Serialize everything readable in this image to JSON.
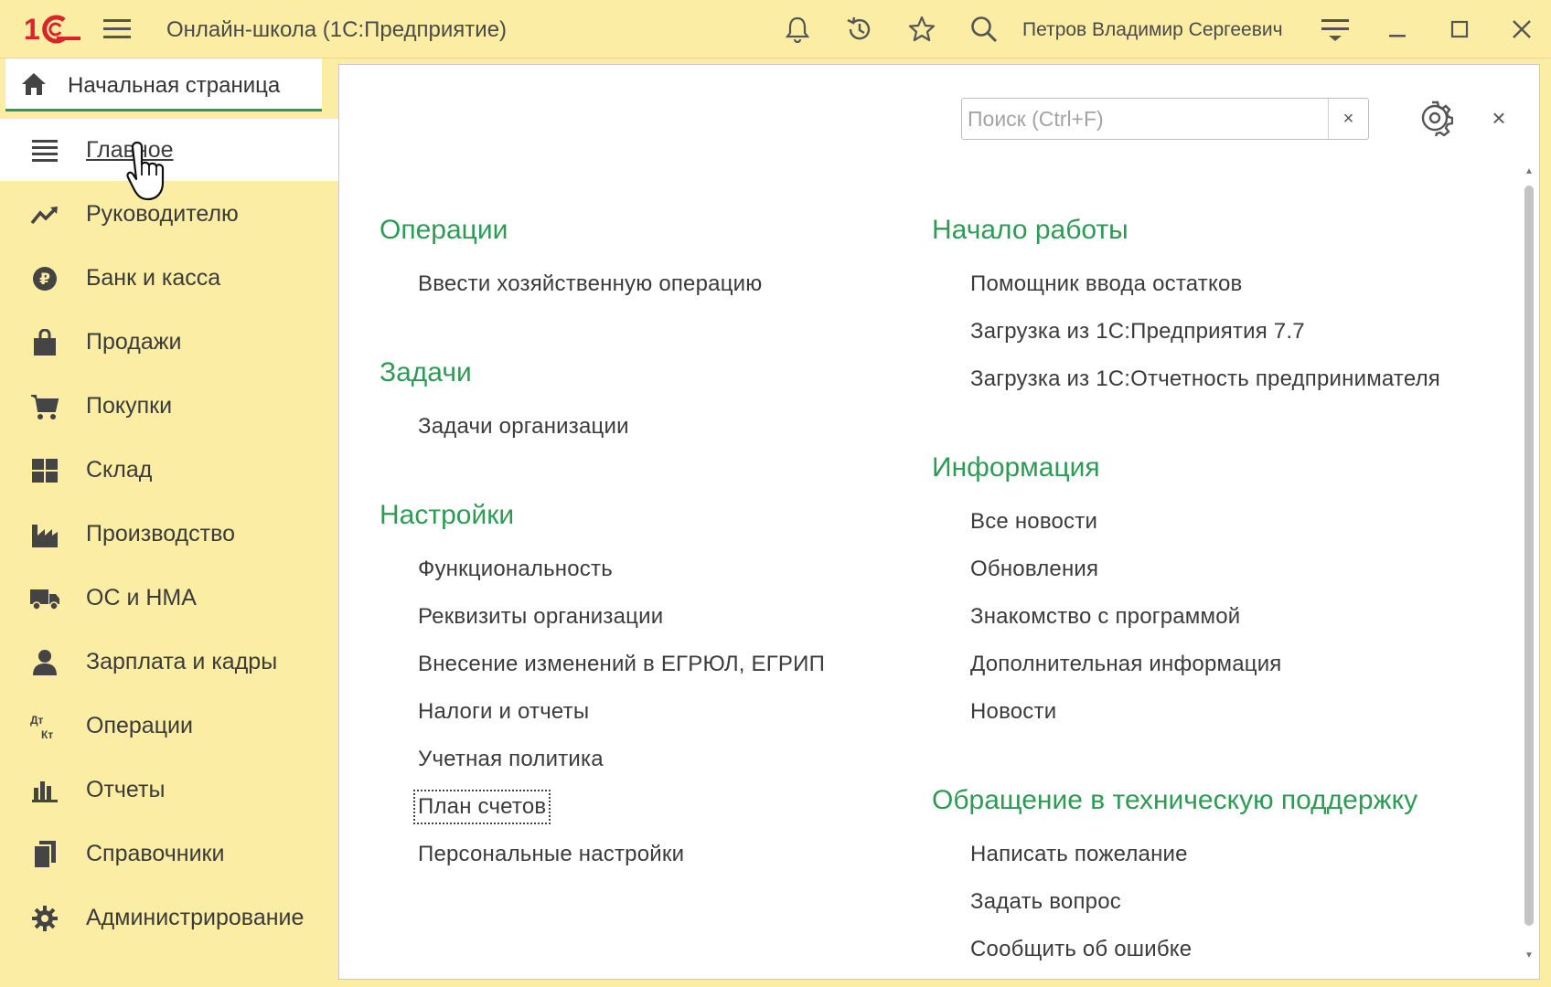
{
  "titlebar": {
    "title": "Онлайн-школа  (1С:Предприятие)",
    "user": "Петров Владимир Сергеевич"
  },
  "home_tab": {
    "label": "Начальная страница"
  },
  "sidebar": {
    "items": [
      {
        "label": "Главное",
        "icon": "menu-icon",
        "active": true
      },
      {
        "label": "Руководителю",
        "icon": "trend-icon"
      },
      {
        "label": "Банк и касса",
        "icon": "ruble-coin-icon"
      },
      {
        "label": "Продажи",
        "icon": "shopping-bag-icon"
      },
      {
        "label": "Покупки",
        "icon": "cart-icon"
      },
      {
        "label": "Склад",
        "icon": "warehouse-icon"
      },
      {
        "label": "Производство",
        "icon": "factory-icon"
      },
      {
        "label": "ОС и НМА",
        "icon": "truck-icon"
      },
      {
        "label": "Зарплата и кадры",
        "icon": "person-icon"
      },
      {
        "label": "Операции",
        "icon": "debit-credit-icon"
      },
      {
        "label": "Отчеты",
        "icon": "bar-chart-icon"
      },
      {
        "label": "Справочники",
        "icon": "books-icon"
      },
      {
        "label": "Администрирование",
        "icon": "gear-icon"
      }
    ]
  },
  "panel": {
    "search_placeholder": "Поиск (Ctrl+F)",
    "search_value": "",
    "clear_label": "×",
    "close_label": "×",
    "left": {
      "operations": {
        "title": "Операции",
        "links": [
          "Ввести хозяйственную операцию"
        ]
      },
      "tasks": {
        "title": "Задачи",
        "links": [
          "Задачи организации"
        ]
      },
      "settings": {
        "title": "Настройки",
        "links": [
          "Функциональность",
          "Реквизиты организации",
          "Внесение изменений в ЕГРЮЛ, ЕГРИП",
          "Налоги и отчеты",
          "Учетная политика",
          "План счетов",
          "Персональные настройки"
        ]
      }
    },
    "right": {
      "start": {
        "title": "Начало работы",
        "links": [
          "Помощник ввода остатков",
          "Загрузка из 1С:Предприятия 7.7",
          "Загрузка из 1С:Отчетность предпринимателя"
        ]
      },
      "info": {
        "title": "Информация",
        "links": [
          "Все новости",
          "Обновления",
          "Знакомство с программой",
          "Дополнительная информация",
          "Новости"
        ]
      },
      "support": {
        "title": "Обращение в техническую поддержку",
        "links": [
          "Написать пожелание",
          "Задать вопрос",
          "Сообщить об ошибке"
        ]
      }
    }
  },
  "colors": {
    "accent_green": "#2e9b55",
    "background_yellow": "#fbeda3",
    "brand_red": "#d8242a"
  }
}
